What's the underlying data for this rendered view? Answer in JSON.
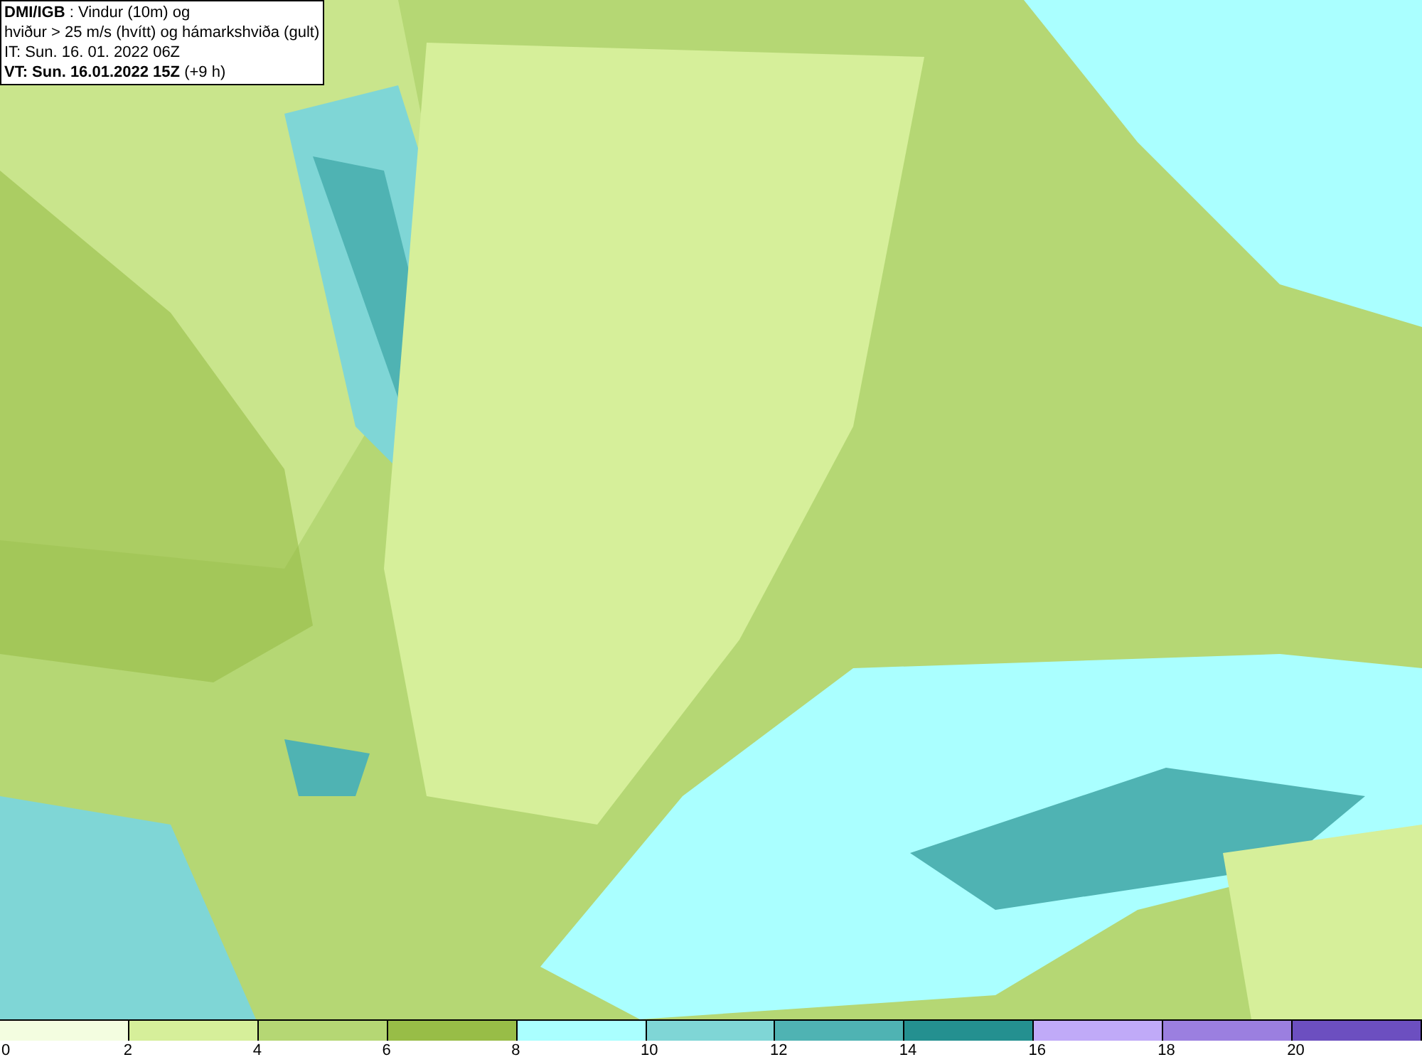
{
  "header": {
    "lines": [
      "**DMI/IGB** : Vindur (10m) og",
      "hviður > 25 m/s (hvítt) og hámarkshviða (gult)",
      "IT: Sun. 16. 01. 2022 06Z",
      "**VT: Sun. 16.01.2022 15Z** (+9 h)"
    ]
  },
  "legend": [
    {
      "color": "#f3fde0",
      "label": "0"
    },
    {
      "color": "#d6ef9a",
      "label": "2"
    },
    {
      "color": "#b5d774",
      "label": "4"
    },
    {
      "color": "#98bd47",
      "label": "6"
    },
    {
      "color": "#aaffff",
      "label": "8"
    },
    {
      "color": "#7fd6d6",
      "label": "10"
    },
    {
      "color": "#4fb3b3",
      "label": "12"
    },
    {
      "color": "#249090",
      "label": "14"
    },
    {
      "color": "#c0aaf8",
      "label": "16"
    },
    {
      "color": "#9b7fe0",
      "label": "18"
    },
    {
      "color": "#6c4fc0",
      "label": "20"
    }
  ]
}
